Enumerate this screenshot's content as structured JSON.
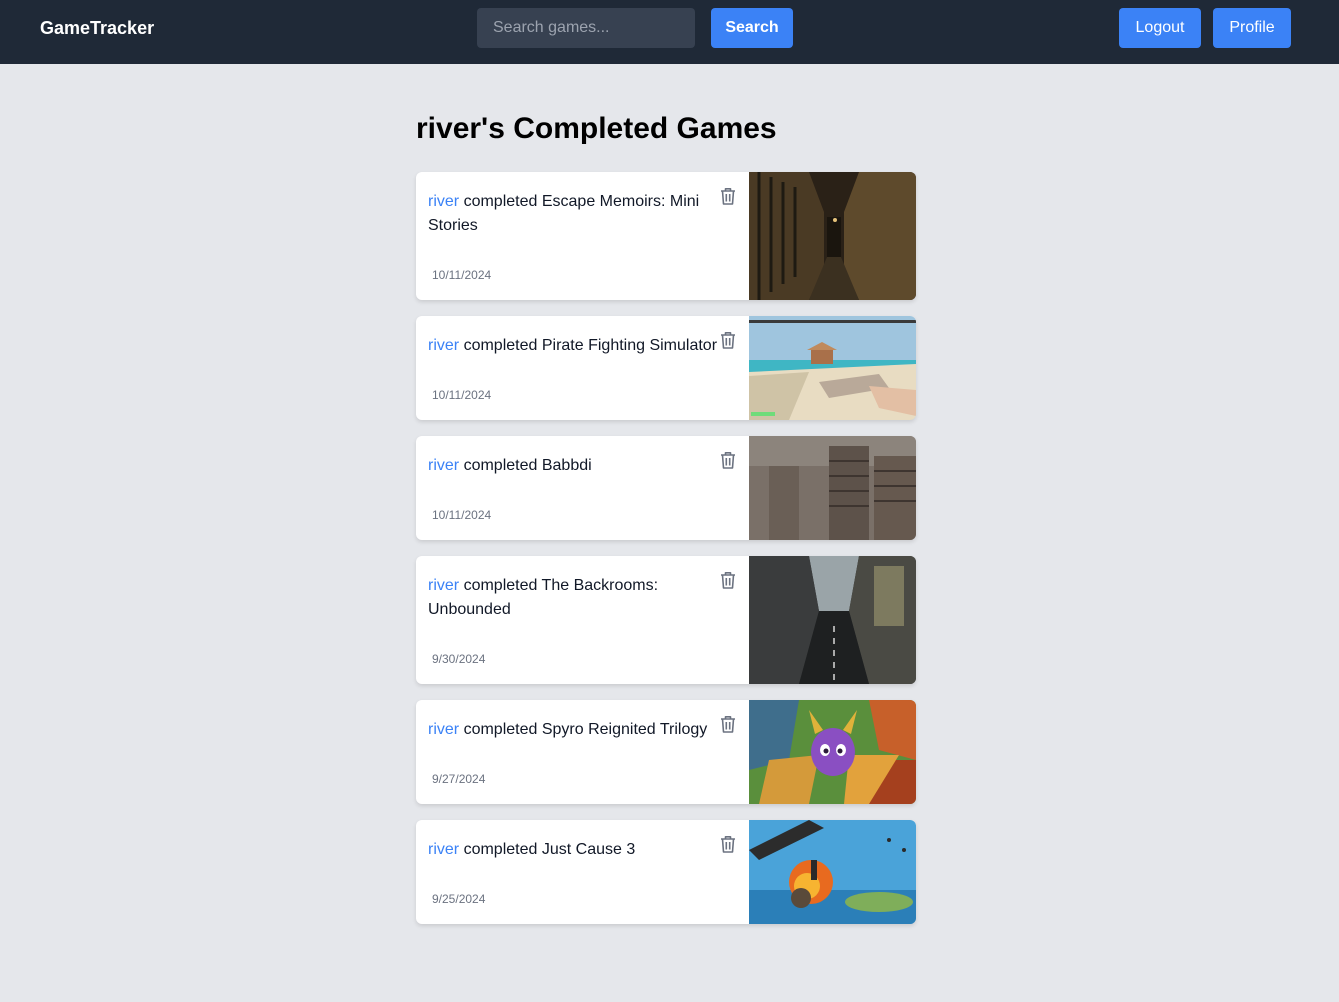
{
  "navbar": {
    "brand": "GameTracker",
    "search_placeholder": "Search games...",
    "search_label": "Search",
    "logout_label": "Logout",
    "profile_label": "Profile"
  },
  "page": {
    "title": "river's Completed Games"
  },
  "completions": [
    {
      "user": "river",
      "action": "completed",
      "game": "Escape Memoirs: Mini Stories",
      "date": "10/11/2024",
      "thumb": "dark-prison-corridor"
    },
    {
      "user": "river",
      "action": "completed",
      "game": "Pirate Fighting Simulator",
      "date": "10/11/2024",
      "thumb": "beach-first-person-gun"
    },
    {
      "user": "river",
      "action": "completed",
      "game": "Babbdi",
      "date": "10/11/2024",
      "thumb": "concrete-towers"
    },
    {
      "user": "river",
      "action": "completed",
      "game": "The Backrooms: Unbounded",
      "date": "9/30/2024",
      "thumb": "empty-city-street"
    },
    {
      "user": "river",
      "action": "completed",
      "game": "Spyro Reignited Trilogy",
      "date": "9/27/2024",
      "thumb": "purple-dragon-art"
    },
    {
      "user": "river",
      "action": "completed",
      "game": "Just Cause 3",
      "date": "9/25/2024",
      "thumb": "explosion-wingsuit"
    }
  ]
}
